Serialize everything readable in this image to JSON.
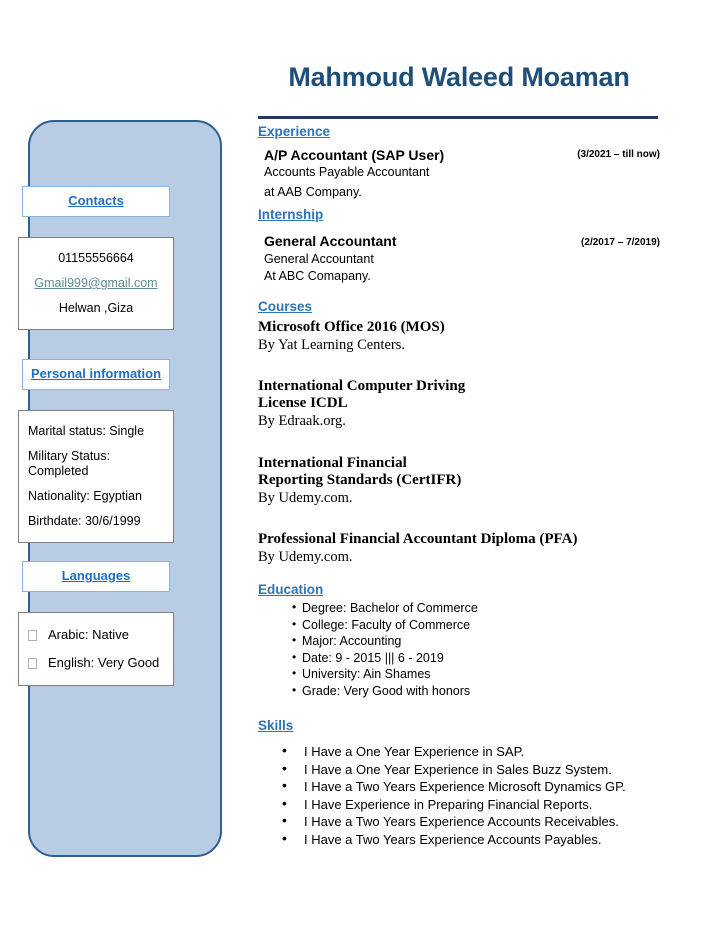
{
  "document": {
    "name": "Mahmoud Waleed Moaman"
  },
  "sidebar": {
    "contacts": {
      "heading": "Contacts",
      "phone": "01155556664",
      "email": "Gmail999@gmail.com",
      "location": "Helwan ,Giza"
    },
    "personal": {
      "heading": "Personal information",
      "items": [
        "Marital status: Single",
        "Military Status: Completed",
        "Nationality: Egyptian",
        "Birthdate: 30/6/1999"
      ]
    },
    "languages": {
      "heading": "Languages",
      "items": [
        "Arabic: Native",
        "English: Very Good"
      ]
    }
  },
  "main": {
    "experience": {
      "heading": "Experience",
      "entries": [
        {
          "title": "A/P Accountant (SAP User)",
          "sub1": "Accounts Payable Accountant",
          "sub2": "at AAB Company.",
          "date": "(3/2021 – till now)"
        }
      ]
    },
    "internship": {
      "heading": "Internship",
      "entries": [
        {
          "title": "General Accountant",
          "sub1": "General Accountant",
          "sub2": "At ABC Comapany.",
          "date": "(2/2017 – 7/2019)"
        }
      ]
    },
    "courses": {
      "heading": "Courses",
      "entries": [
        {
          "title": "Microsoft Office 2016 (MOS)",
          "by": "By Yat Learning Centers."
        },
        {
          "title": "International Computer Driving\nLicense ICDL",
          "by": "By Edraak.org."
        },
        {
          "title": "International Financial\nReporting Standards (CertIFR)",
          "by": "By Udemy.com."
        },
        {
          "title": "Professional Financial Accountant Diploma (PFA)",
          "by": "By Udemy.com."
        }
      ]
    },
    "education": {
      "heading": "Education",
      "items": [
        "Degree: Bachelor of Commerce",
        "College: Faculty of Commerce",
        "Major: Accounting",
        "Date: 9 - 2015 |||  6 - 2019",
        "University: Ain Shames",
        "Grade: Very Good with honors"
      ]
    },
    "skills": {
      "heading": "Skills",
      "items": [
        "I Have a One Year Experience in SAP.",
        "I Have a One Year Experience in Sales Buzz System.",
        "I Have a Two Years Experience Microsoft Dynamics GP.",
        "I Have Experience in Preparing Financial Reports.",
        "I Have a Two Years Experience Accounts Receivables.",
        "I Have a Two Years Experience Accounts Payables."
      ]
    }
  },
  "colors": {
    "name_blue": "#1f4e79",
    "rule_navy": "#1f3864",
    "section_blue": "#2e74b5",
    "panel_fill": "#b8cce4",
    "panel_border": "#2e5f8f",
    "email_link": "#5d8a93"
  }
}
